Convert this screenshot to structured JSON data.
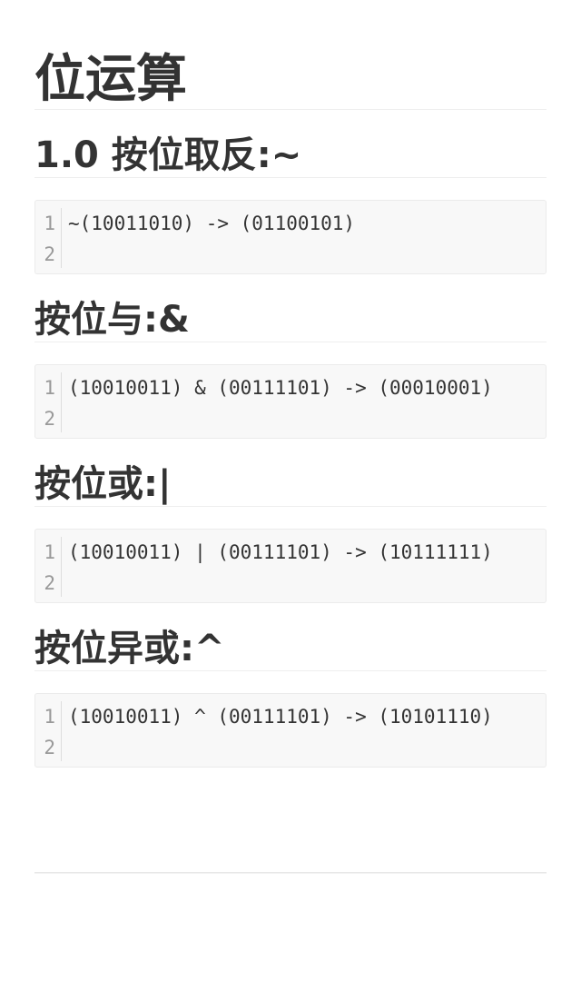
{
  "title": "位运算",
  "sections": [
    {
      "heading": "1.0 按位取反:~",
      "code": {
        "line_numbers": [
          "1",
          "2"
        ],
        "lines": [
          "~(10011010) -> (01100101)",
          ""
        ]
      }
    },
    {
      "heading": "按位与:&",
      "code": {
        "line_numbers": [
          "1",
          "2"
        ],
        "lines": [
          "(10010011) & (00111101) -> (00010001)",
          ""
        ]
      }
    },
    {
      "heading": "按位或:|",
      "code": {
        "line_numbers": [
          "1",
          "2"
        ],
        "lines": [
          "(10010011) | (00111101) -> (10111111)",
          ""
        ]
      }
    },
    {
      "heading": "按位异或:^",
      "code": {
        "line_numbers": [
          "1",
          "2"
        ],
        "lines": [
          "(10010011) ^ (00111101) -> (10101110)",
          ""
        ]
      }
    }
  ]
}
